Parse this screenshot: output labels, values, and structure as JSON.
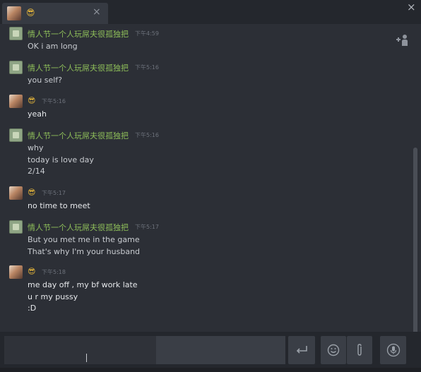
{
  "tab": {
    "title_emoji": "😎",
    "close_glyph": "×"
  },
  "window": {
    "close_glyph": "×"
  },
  "messages": [
    {
      "sender": "情人节一个人玩屌夫很孤独把",
      "time": "下午4:59",
      "lines": [
        "OK i am long"
      ]
    },
    {
      "sender": "情人节一个人玩屌夫很孤独把",
      "time": "下午5:16",
      "lines": [
        "you self?"
      ]
    },
    {
      "sender": "😎",
      "time": "下午5:16",
      "lines": [
        "yeah"
      ]
    },
    {
      "sender": "情人节一个人玩屌夫很孤独把",
      "time": "下午5:16",
      "lines": [
        "why",
        "today is love day",
        "2/14"
      ]
    },
    {
      "sender": "😎",
      "time": "下午5:17",
      "lines": [
        "no time to meet"
      ]
    },
    {
      "sender": "情人节一个人玩屌夫很孤独把",
      "time": "下午5:17",
      "lines": [
        "But you met me in the game",
        "That's why I'm your husband"
      ]
    },
    {
      "sender": "😎",
      "time": "下午5:18",
      "lines": [
        "me day off , my bf work late",
        "u r my pussy",
        ":D"
      ]
    }
  ],
  "icons": {
    "add_friend": "add-friend-icon",
    "send": "enter-arrow-icon",
    "emoji": "smiley-icon",
    "attach": "paperclip-icon",
    "voice": "microphone-icon"
  },
  "colors": {
    "background": "#2c2f36",
    "sender_name": "#8ebe59",
    "timestamp": "#6d727b",
    "self_emoji": "#e2b33a"
  }
}
